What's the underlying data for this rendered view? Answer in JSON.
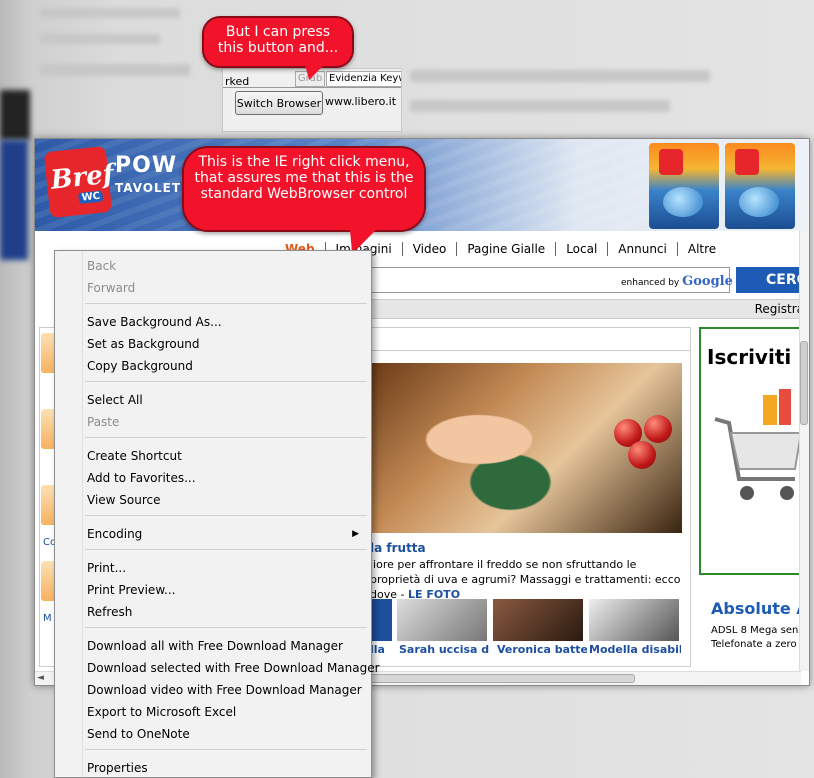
{
  "callouts": {
    "top": "But I can press this button and...",
    "mid": "This is the IE right click menu, that assures me that this is the standard WebBrowser control"
  },
  "switch_strip": {
    "marked_text": "rked",
    "grab_label": "Grab",
    "evidenzia_label": "Evidenzia Keyw",
    "switch_button_label": "Switch Browser",
    "url_text": "www.libero.it"
  },
  "page": {
    "brand_title": "POW",
    "brand_sub": "TAVOLET",
    "logo_text": "Bref",
    "logo_badge": "WC",
    "nav": [
      "Web",
      "Immagini",
      "Video",
      "Pagine Gialle",
      "Local",
      "Annunci",
      "Altre"
    ],
    "enhanced_by": "enhanced by",
    "google": "Google",
    "search_button": "CERC",
    "registra": "Registra",
    "headline": "la frutta",
    "summary": "liore per affrontare il freddo se non sfruttando le proprietà di uva e agrumi? Massaggi e trattamenti: ecco dove -",
    "summary_more": "LE FOTO",
    "news": [
      {
        "caption": "Sarah uccisa da"
      },
      {
        "caption": "Veronica batte"
      },
      {
        "caption": "Modella disabile"
      }
    ],
    "news_left_caption": "lla",
    "left_labels": [
      "Co",
      "M"
    ],
    "ad_title": "Iscriviti",
    "promo_title": "Absolute A",
    "promo_line1": "ADSL 8 Mega senz",
    "promo_line2": "Telefonate a zero"
  },
  "context_menu": {
    "items": [
      {
        "label": "Back",
        "disabled": true
      },
      {
        "label": "Forward",
        "disabled": true
      },
      {
        "label": "Save Background As...",
        "disabled": false
      },
      {
        "label": "Set as Background",
        "disabled": false
      },
      {
        "label": "Copy Background",
        "disabled": false
      },
      {
        "label": "Select All",
        "disabled": false
      },
      {
        "label": "Paste",
        "disabled": true
      },
      {
        "label": "Create Shortcut",
        "disabled": false
      },
      {
        "label": "Add to Favorites...",
        "disabled": false
      },
      {
        "label": "View Source",
        "disabled": false
      },
      {
        "label": "Encoding",
        "disabled": false,
        "submenu": true
      },
      {
        "label": "Print...",
        "disabled": false
      },
      {
        "label": "Print Preview...",
        "disabled": false
      },
      {
        "label": "Refresh",
        "disabled": false
      },
      {
        "label": "Download all with Free Download Manager",
        "disabled": false
      },
      {
        "label": "Download selected with Free Download Manager",
        "disabled": false
      },
      {
        "label": "Download video with Free Download Manager",
        "disabled": false
      },
      {
        "label": "Export to Microsoft Excel",
        "disabled": false
      },
      {
        "label": "Send to OneNote",
        "disabled": false
      },
      {
        "label": "Properties",
        "disabled": false
      }
    ]
  },
  "colors": {
    "callout_red": "#f2132b",
    "link_blue": "#1d4fa0",
    "search_blue": "#1d5bb5"
  }
}
